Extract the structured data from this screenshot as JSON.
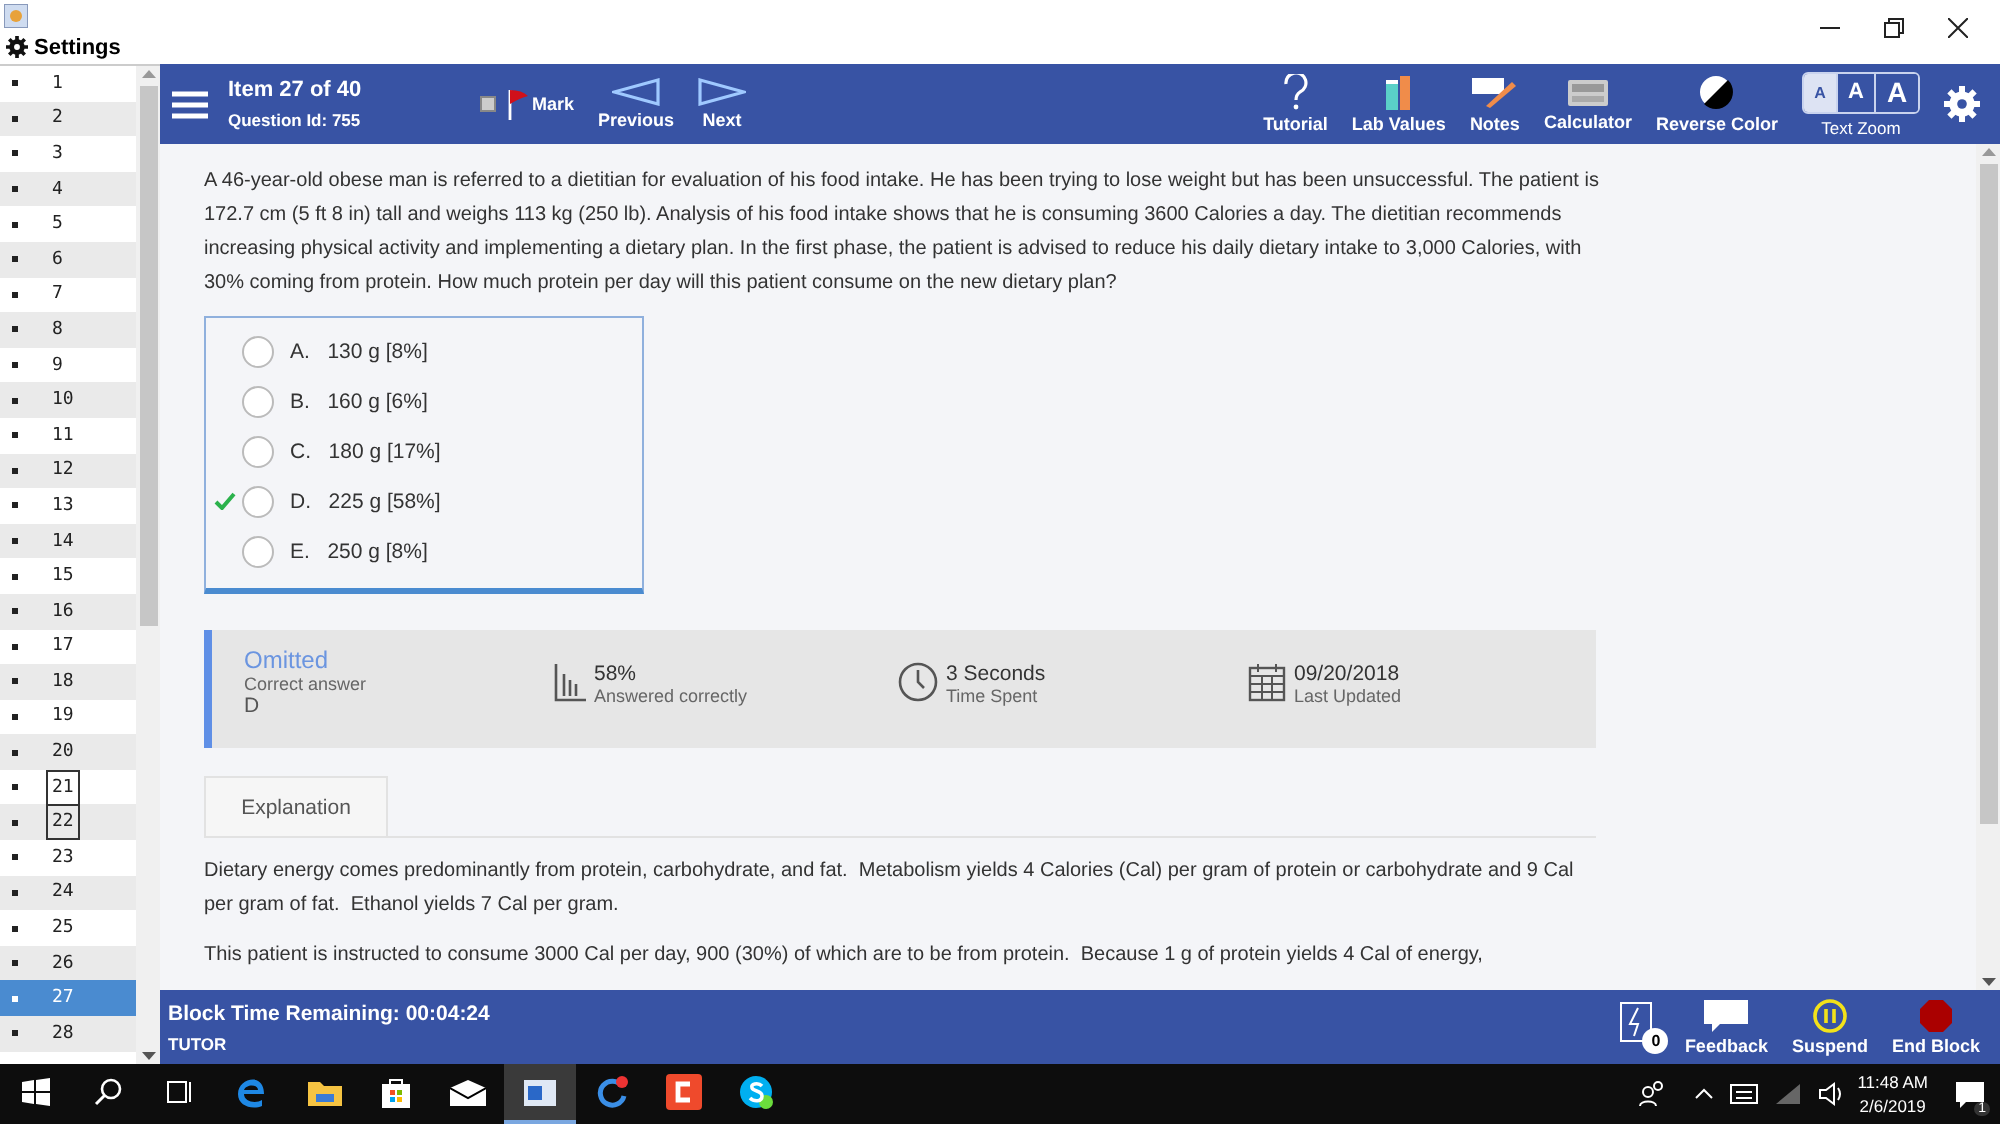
{
  "window": {
    "menu_label": "Settings"
  },
  "sidebar": {
    "items": [
      {
        "label": "1",
        "selected": false,
        "marked": false
      },
      {
        "label": "2",
        "selected": false,
        "marked": false
      },
      {
        "label": "3",
        "selected": false,
        "marked": false
      },
      {
        "label": "4",
        "selected": false,
        "marked": false
      },
      {
        "label": "5",
        "selected": false,
        "marked": false
      },
      {
        "label": "6",
        "selected": false,
        "marked": false
      },
      {
        "label": "7",
        "selected": false,
        "marked": false
      },
      {
        "label": "8",
        "selected": false,
        "marked": false
      },
      {
        "label": "9",
        "selected": false,
        "marked": false
      },
      {
        "label": "10",
        "selected": false,
        "marked": false
      },
      {
        "label": "11",
        "selected": false,
        "marked": false
      },
      {
        "label": "12",
        "selected": false,
        "marked": false
      },
      {
        "label": "13",
        "selected": false,
        "marked": false
      },
      {
        "label": "14",
        "selected": false,
        "marked": false
      },
      {
        "label": "15",
        "selected": false,
        "marked": false
      },
      {
        "label": "16",
        "selected": false,
        "marked": false
      },
      {
        "label": "17",
        "selected": false,
        "marked": false
      },
      {
        "label": "18",
        "selected": false,
        "marked": false
      },
      {
        "label": "19",
        "selected": false,
        "marked": false
      },
      {
        "label": "20",
        "selected": false,
        "marked": false
      },
      {
        "label": "21",
        "selected": false,
        "marked": true
      },
      {
        "label": "22",
        "selected": false,
        "marked": true
      },
      {
        "label": "23",
        "selected": false,
        "marked": false
      },
      {
        "label": "24",
        "selected": false,
        "marked": false
      },
      {
        "label": "25",
        "selected": false,
        "marked": false
      },
      {
        "label": "26",
        "selected": false,
        "marked": false
      },
      {
        "label": "27",
        "selected": true,
        "marked": false
      },
      {
        "label": "28",
        "selected": false,
        "marked": false
      }
    ]
  },
  "toolbar": {
    "item": "Item 27 of 40",
    "question_id": "Question Id: 755",
    "mark": {
      "label": "Mark",
      "checked": false
    },
    "nav": [
      {
        "kind": "prev",
        "label": "Previous"
      },
      {
        "kind": "next",
        "label": "Next"
      }
    ],
    "tools": [
      {
        "kind": "tutorial",
        "label": "Tutorial"
      },
      {
        "kind": "lab",
        "label": "Lab Values"
      },
      {
        "kind": "notes",
        "label": "Notes"
      },
      {
        "kind": "calculator",
        "label": "Calculator"
      },
      {
        "kind": "reverse",
        "label": "Reverse Color"
      }
    ],
    "text_zoom": {
      "label": "Text Zoom",
      "sizes": [
        {
          "label": "A",
          "selected": true
        },
        {
          "label": "A",
          "selected": false
        },
        {
          "label": "A",
          "selected": false
        }
      ]
    }
  },
  "question": {
    "stem": "A 46-year-old obese man is referred to a dietitian for evaluation of his food intake.  He has been trying to lose weight but has been unsuccessful.  The patient is 172.7 cm (5 ft 8 in) tall and weighs 113 kg (250 lb).  Analysis of his food intake shows that he is consuming 3600 Calories a day.  The dietitian recommends increasing physical activity and implementing a dietary plan.  In the first phase, the patient is advised to reduce his daily dietary intake to 3,000 Calories, with 30% coming from protein.  How much protein per day will this patient consume on the new dietary plan?",
    "choices": [
      {
        "letter": "A.",
        "text": "130 g [8%]",
        "correct": false,
        "selected": false
      },
      {
        "letter": "B.",
        "text": "160 g [6%]",
        "correct": false,
        "selected": false
      },
      {
        "letter": "C.",
        "text": "180 g [17%]",
        "correct": false,
        "selected": false
      },
      {
        "letter": "D.",
        "text": "225 g [58%]",
        "correct": true,
        "selected": false
      },
      {
        "letter": "E.",
        "text": "250 g [8%]",
        "correct": false,
        "selected": false
      }
    ]
  },
  "result": {
    "status": "Omitted",
    "correct_label": "Correct answer",
    "correct_value": "D",
    "stats": [
      {
        "kind": "percent",
        "value": "58%",
        "label": "Answered correctly"
      },
      {
        "kind": "time",
        "value": "3 Seconds",
        "label": "Time Spent"
      },
      {
        "kind": "date",
        "value": "09/20/2018",
        "label": "Last Updated"
      }
    ]
  },
  "explanation": {
    "tab": "Explanation",
    "paragraphs": [
      "Dietary energy comes predominantly from protein, carbohydrate, and fat.  Metabolism yields 4 Calories (Cal) per gram of protein or carbohydrate and 9 Cal per gram of fat.  Ethanol yields 7 Cal per gram.",
      "This patient is instructed to consume 3000 Cal per day, 900 (30%) of which are to be from protein.  Because 1 g of protein yields 4 Cal of energy,"
    ]
  },
  "footer": {
    "timer": "Block Time Remaining: 00:04:24",
    "mode": "TUTOR",
    "notifications": "0",
    "actions": [
      {
        "kind": "feedback",
        "label": "Feedback"
      },
      {
        "kind": "suspend",
        "label": "Suspend"
      },
      {
        "kind": "end",
        "label": "End Block"
      }
    ]
  },
  "taskbar": {
    "apps": [
      {
        "kind": "edge",
        "selected": false
      },
      {
        "kind": "folder",
        "selected": false
      },
      {
        "kind": "store",
        "selected": false
      },
      {
        "kind": "mail",
        "selected": false
      },
      {
        "kind": "window",
        "selected": true
      },
      {
        "kind": "chrome",
        "selected": false
      },
      {
        "kind": "c",
        "selected": false
      },
      {
        "kind": "skype",
        "selected": false
      }
    ],
    "time": "11:48 AM",
    "date": "2/6/2019",
    "notif_count": "1"
  }
}
